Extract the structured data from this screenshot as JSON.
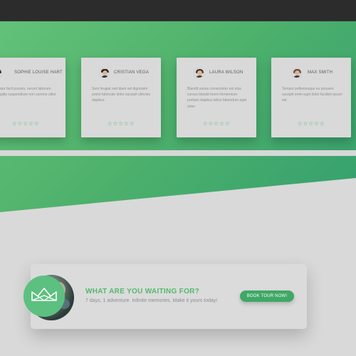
{
  "testimonials": [
    {
      "name": "SOPHIE LOUISE HART",
      "quote": "ullatur facil possim, nerunt laborum fringilla suspendisse non summo ultior",
      "rating": 4,
      "stars": "☆☆☆☆☆",
      "avatar_icon": "avatar-woman-icon"
    },
    {
      "name": "CRISTIAN VEGA",
      "quote": "Sem feugiat sed diam vel dignissim pretio fabricate dolor suscipit ultricies dapibus",
      "rating": 5,
      "stars": "☆☆☆☆☆",
      "avatar_icon": "avatar-man-icon"
    },
    {
      "name": "LAURA WILSON",
      "quote": "Blandit varius consectetur est elus cursus blandit lorem fermentum pretium dapibus tellus bibendum eget dolor",
      "rating": 5,
      "stars": "☆☆☆☆☆",
      "avatar_icon": "avatar-woman-icon"
    },
    {
      "name": "MAX SMITH",
      "quote": "Tempor pellentesque eu posuere suscipit enim eget dolor facilisis ipsum est",
      "rating": 5,
      "stars": "☆☆☆☆☆",
      "avatar_icon": "avatar-man-icon"
    }
  ],
  "cta": {
    "title": "WHAT ARE YOU WAITING FOR?",
    "subtitle": "7 days, 1 adventure. Infinite memories. Make it yours today!",
    "button": "BOOK TOUR NOW!",
    "logo_icon": "crown-icon"
  },
  "colors": {
    "accent": "#54b86f",
    "hero_gradient_start": "#63c178",
    "hero_gradient_end": "#35a06e",
    "button": "#3fa866",
    "background": "#d9d9d9"
  }
}
